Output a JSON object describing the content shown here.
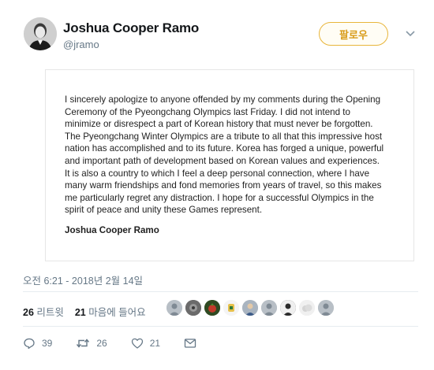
{
  "author": {
    "name": "Joshua Cooper Ramo",
    "handle": "@jramo"
  },
  "follow_label": "팔로우",
  "statement": {
    "body": "I sincerely apologize to anyone offended by my comments during the Opening Ceremony of the Pyeongchang Olympics last Friday. I did not intend to minimize or disrespect a part of Korean history that must never be forgotten. The Pyeongchang Winter Olympics are a tribute to all that this impressive host nation has accomplished and to its future. Korea has forged a unique, powerful and important path of development based on Korean values and experiences. It is also a country to which I feel a deep personal connection, where I have many warm friendships and fond memories from years of travel, so this makes me particularly regret any distraction. I hope for a successful Olympics in the spirit of peace and unity these Games represent.",
    "signature": "Joshua Cooper Ramo"
  },
  "timestamp": "오전 6:21 - 2018년 2월 14일",
  "stats": {
    "retweet_count": "26",
    "retweet_label": "리트윗",
    "like_count": "21",
    "like_label": "마음에 들어요"
  },
  "actions": {
    "replies": "39",
    "retweets": "26",
    "likes": "21"
  },
  "colors": {
    "follow_accent": "#e8b53a",
    "muted_text": "#657786"
  }
}
